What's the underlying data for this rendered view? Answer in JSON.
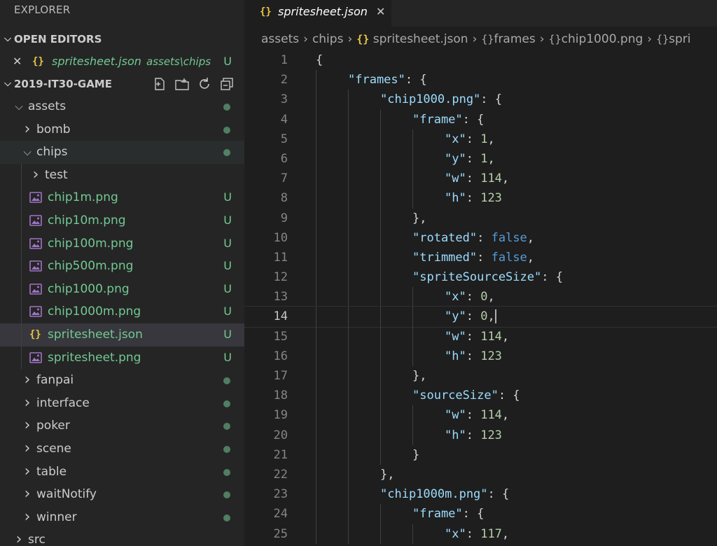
{
  "explorer": {
    "title": "EXPLORER",
    "open_editors": {
      "label": "OPEN EDITORS",
      "items": [
        {
          "name": "spritesheet.json",
          "path": "assets\\chips",
          "status": "U"
        }
      ]
    },
    "project": {
      "label": "2019-IT30-GAME",
      "actions": [
        "new-file-icon",
        "new-folder-icon",
        "refresh-icon",
        "collapse-all-icon"
      ]
    },
    "tree": [
      {
        "label": "assets",
        "type": "folder",
        "expanded": true,
        "depth": 1,
        "decoration": "dot"
      },
      {
        "label": "bomb",
        "type": "folder",
        "expanded": false,
        "depth": 2,
        "decoration": "dot"
      },
      {
        "label": "chips",
        "type": "folder",
        "expanded": true,
        "depth": 2,
        "decoration": "dot"
      },
      {
        "label": "test",
        "type": "folder",
        "expanded": false,
        "depth": 3,
        "decoration": ""
      },
      {
        "label": "chip1m.png",
        "type": "image",
        "depth": 3,
        "decoration": "U"
      },
      {
        "label": "chip10m.png",
        "type": "image",
        "depth": 3,
        "decoration": "U"
      },
      {
        "label": "chip100m.png",
        "type": "image",
        "depth": 3,
        "decoration": "U"
      },
      {
        "label": "chip500m.png",
        "type": "image",
        "depth": 3,
        "decoration": "U"
      },
      {
        "label": "chip1000.png",
        "type": "image",
        "depth": 3,
        "decoration": "U"
      },
      {
        "label": "chip1000m.png",
        "type": "image",
        "depth": 3,
        "decoration": "U"
      },
      {
        "label": "spritesheet.json",
        "type": "json",
        "depth": 3,
        "decoration": "U",
        "selected": true
      },
      {
        "label": "spritesheet.png",
        "type": "image",
        "depth": 3,
        "decoration": "U"
      },
      {
        "label": "fanpai",
        "type": "folder",
        "expanded": false,
        "depth": 2,
        "decoration": "dot"
      },
      {
        "label": "interface",
        "type": "folder",
        "expanded": false,
        "depth": 2,
        "decoration": "dot"
      },
      {
        "label": "poker",
        "type": "folder",
        "expanded": false,
        "depth": 2,
        "decoration": "dot"
      },
      {
        "label": "scene",
        "type": "folder",
        "expanded": false,
        "depth": 2,
        "decoration": "dot"
      },
      {
        "label": "table",
        "type": "folder",
        "expanded": false,
        "depth": 2,
        "decoration": "dot"
      },
      {
        "label": "waitNotify",
        "type": "folder",
        "expanded": false,
        "depth": 2,
        "decoration": "dot"
      },
      {
        "label": "winner",
        "type": "folder",
        "expanded": false,
        "depth": 2,
        "decoration": "dot"
      },
      {
        "label": "src",
        "type": "folder",
        "expanded": false,
        "depth": 1,
        "decoration": ""
      }
    ]
  },
  "tab": {
    "icon": "{}",
    "label": "spritesheet.json",
    "close": "✕"
  },
  "breadcrumb": {
    "items": [
      {
        "label": "assets",
        "kind": "folder"
      },
      {
        "label": "chips",
        "kind": "folder"
      },
      {
        "label": "spritesheet.json",
        "kind": "json"
      },
      {
        "label": "frames",
        "kind": "object"
      },
      {
        "label": "chip1000.png",
        "kind": "object"
      },
      {
        "label": "spri",
        "kind": "object"
      }
    ]
  },
  "editor": {
    "current_line": 14,
    "lines": [
      {
        "n": "1",
        "indent": 0,
        "tokens": [
          [
            "p",
            "{"
          ]
        ]
      },
      {
        "n": "2",
        "indent": 1,
        "tokens": [
          [
            "k",
            "\"frames\""
          ],
          [
            "p",
            ": {"
          ]
        ]
      },
      {
        "n": "3",
        "indent": 2,
        "tokens": [
          [
            "k",
            "\"chip1000.png\""
          ],
          [
            "p",
            ": {"
          ]
        ]
      },
      {
        "n": "4",
        "indent": 3,
        "tokens": [
          [
            "k",
            "\"frame\""
          ],
          [
            "p",
            ": {"
          ]
        ]
      },
      {
        "n": "5",
        "indent": 4,
        "tokens": [
          [
            "k",
            "\"x\""
          ],
          [
            "p",
            ": "
          ],
          [
            "n",
            "1"
          ],
          [
            "p",
            ","
          ]
        ]
      },
      {
        "n": "6",
        "indent": 4,
        "tokens": [
          [
            "k",
            "\"y\""
          ],
          [
            "p",
            ": "
          ],
          [
            "n",
            "1"
          ],
          [
            "p",
            ","
          ]
        ]
      },
      {
        "n": "7",
        "indent": 4,
        "tokens": [
          [
            "k",
            "\"w\""
          ],
          [
            "p",
            ": "
          ],
          [
            "n",
            "114"
          ],
          [
            "p",
            ","
          ]
        ]
      },
      {
        "n": "8",
        "indent": 4,
        "tokens": [
          [
            "k",
            "\"h\""
          ],
          [
            "p",
            ": "
          ],
          [
            "n",
            "123"
          ]
        ]
      },
      {
        "n": "9",
        "indent": 3,
        "tokens": [
          [
            "p",
            "},"
          ]
        ]
      },
      {
        "n": "10",
        "indent": 3,
        "tokens": [
          [
            "k",
            "\"rotated\""
          ],
          [
            "p",
            ": "
          ],
          [
            "b",
            "false"
          ],
          [
            "p",
            ","
          ]
        ]
      },
      {
        "n": "11",
        "indent": 3,
        "tokens": [
          [
            "k",
            "\"trimmed\""
          ],
          [
            "p",
            ": "
          ],
          [
            "b",
            "false"
          ],
          [
            "p",
            ","
          ]
        ]
      },
      {
        "n": "12",
        "indent": 3,
        "tokens": [
          [
            "k",
            "\"spriteSourceSize\""
          ],
          [
            "p",
            ": {"
          ]
        ]
      },
      {
        "n": "13",
        "indent": 4,
        "tokens": [
          [
            "k",
            "\"x\""
          ],
          [
            "p",
            ": "
          ],
          [
            "n",
            "0"
          ],
          [
            "p",
            ","
          ]
        ]
      },
      {
        "n": "14",
        "indent": 4,
        "tokens": [
          [
            "k",
            "\"y\""
          ],
          [
            "p",
            ": "
          ],
          [
            "n",
            "0"
          ],
          [
            "p",
            ","
          ]
        ],
        "cursor": true
      },
      {
        "n": "15",
        "indent": 4,
        "tokens": [
          [
            "k",
            "\"w\""
          ],
          [
            "p",
            ": "
          ],
          [
            "n",
            "114"
          ],
          [
            "p",
            ","
          ]
        ]
      },
      {
        "n": "16",
        "indent": 4,
        "tokens": [
          [
            "k",
            "\"h\""
          ],
          [
            "p",
            ": "
          ],
          [
            "n",
            "123"
          ]
        ]
      },
      {
        "n": "17",
        "indent": 3,
        "tokens": [
          [
            "p",
            "},"
          ]
        ]
      },
      {
        "n": "18",
        "indent": 3,
        "tokens": [
          [
            "k",
            "\"sourceSize\""
          ],
          [
            "p",
            ": {"
          ]
        ]
      },
      {
        "n": "19",
        "indent": 4,
        "tokens": [
          [
            "k",
            "\"w\""
          ],
          [
            "p",
            ": "
          ],
          [
            "n",
            "114"
          ],
          [
            "p",
            ","
          ]
        ]
      },
      {
        "n": "20",
        "indent": 4,
        "tokens": [
          [
            "k",
            "\"h\""
          ],
          [
            "p",
            ": "
          ],
          [
            "n",
            "123"
          ]
        ]
      },
      {
        "n": "21",
        "indent": 3,
        "tokens": [
          [
            "p",
            "}"
          ]
        ]
      },
      {
        "n": "22",
        "indent": 2,
        "tokens": [
          [
            "p",
            "},"
          ]
        ]
      },
      {
        "n": "23",
        "indent": 2,
        "tokens": [
          [
            "k",
            "\"chip1000m.png\""
          ],
          [
            "p",
            ": {"
          ]
        ]
      },
      {
        "n": "24",
        "indent": 3,
        "tokens": [
          [
            "k",
            "\"frame\""
          ],
          [
            "p",
            ": {"
          ]
        ]
      },
      {
        "n": "25",
        "indent": 4,
        "tokens": [
          [
            "k",
            "\"x\""
          ],
          [
            "p",
            ": "
          ],
          [
            "n",
            "117"
          ],
          [
            "p",
            ","
          ]
        ]
      }
    ]
  },
  "colors": {
    "sidebar_bg": "#252526",
    "editor_bg": "#1e1e1e",
    "git_untracked": "#73c991",
    "json_key": "#9cdcfe",
    "json_number": "#b5cea8",
    "json_bool": "#569cd6",
    "json_icon": "#e8c547"
  }
}
